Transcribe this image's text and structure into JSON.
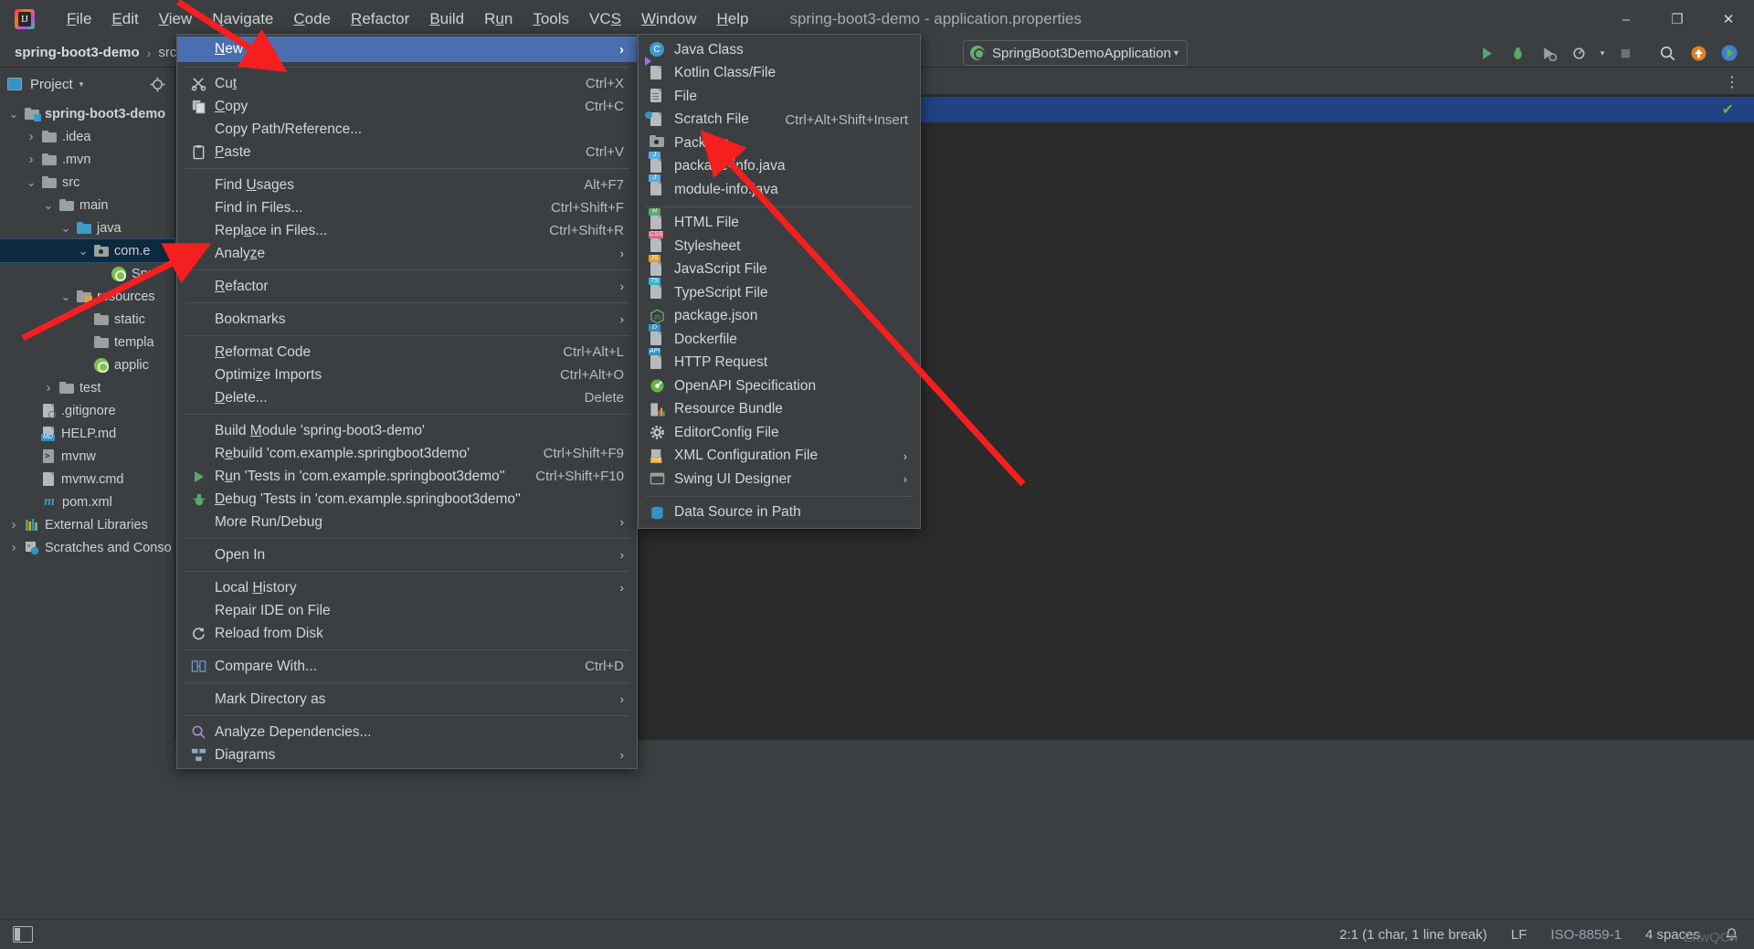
{
  "titlebar": {
    "menus": [
      {
        "label": "File",
        "mnemonic": "F"
      },
      {
        "label": "Edit",
        "mnemonic": "E"
      },
      {
        "label": "View",
        "mnemonic": "V"
      },
      {
        "label": "Navigate",
        "mnemonic": "N"
      },
      {
        "label": "Code",
        "mnemonic": "C"
      },
      {
        "label": "Refactor",
        "mnemonic": "R"
      },
      {
        "label": "Build",
        "mnemonic": "B"
      },
      {
        "label": "Run",
        "mnemonic": "u"
      },
      {
        "label": "Tools",
        "mnemonic": "T"
      },
      {
        "label": "VCS",
        "mnemonic": "S"
      },
      {
        "label": "Window",
        "mnemonic": "W"
      },
      {
        "label": "Help",
        "mnemonic": "H"
      }
    ],
    "window_title": "spring-boot3-demo - application.properties",
    "minimize": "–",
    "maximize": "❐",
    "close": "✕"
  },
  "navbar": {
    "crumbs": [
      "spring-boot3-demo",
      "src"
    ],
    "separator": "›",
    "run_config": "SpringBoot3DemoApplication",
    "run_caret": "▾"
  },
  "project_panel": {
    "title": "Project",
    "caret": "▾",
    "tree": [
      {
        "label": "spring-boot3-demo",
        "depth": 0,
        "arrow": "down",
        "icon": "module-folder",
        "bold": true
      },
      {
        "label": ".idea",
        "depth": 1,
        "arrow": "right",
        "icon": "folder"
      },
      {
        "label": ".mvn",
        "depth": 1,
        "arrow": "right",
        "icon": "folder"
      },
      {
        "label": "src",
        "depth": 1,
        "arrow": "down",
        "icon": "folder"
      },
      {
        "label": "main",
        "depth": 2,
        "arrow": "down",
        "icon": "folder"
      },
      {
        "label": "java",
        "depth": 3,
        "arrow": "down",
        "icon": "source-folder"
      },
      {
        "label": "com.e",
        "depth": 4,
        "arrow": "down",
        "icon": "package",
        "selected": true
      },
      {
        "label": "Spr",
        "depth": 5,
        "arrow": "none",
        "icon": "spring-class"
      },
      {
        "label": "resources",
        "depth": 3,
        "arrow": "down",
        "icon": "resources-folder"
      },
      {
        "label": "static",
        "depth": 4,
        "arrow": "none",
        "icon": "folder"
      },
      {
        "label": "templa",
        "depth": 4,
        "arrow": "none",
        "icon": "folder"
      },
      {
        "label": "applic",
        "depth": 4,
        "arrow": "none",
        "icon": "spring-properties"
      },
      {
        "label": "test",
        "depth": 2,
        "arrow": "right",
        "icon": "folder"
      },
      {
        "label": ".gitignore",
        "depth": 1,
        "arrow": "none",
        "icon": "gitignore-file"
      },
      {
        "label": "HELP.md",
        "depth": 1,
        "arrow": "none",
        "icon": "md-file"
      },
      {
        "label": "mvnw",
        "depth": 1,
        "arrow": "none",
        "icon": "shell-file"
      },
      {
        "label": "mvnw.cmd",
        "depth": 1,
        "arrow": "none",
        "icon": "cmd-file"
      },
      {
        "label": "pom.xml",
        "depth": 1,
        "arrow": "none",
        "icon": "maven-file"
      },
      {
        "label": "External Libraries",
        "depth": 0,
        "arrow": "right",
        "icon": "libraries"
      },
      {
        "label": "Scratches and Conso",
        "depth": 0,
        "arrow": "right",
        "icon": "scratches"
      }
    ]
  },
  "context_menu": {
    "items": [
      {
        "label": "New",
        "mnemonic": "N",
        "icon": "",
        "submenu": true,
        "highlighted": true
      },
      {
        "separator": true
      },
      {
        "label": "Cut",
        "mnemonic": "t",
        "icon": "scissors-icon",
        "accel": "Ctrl+X"
      },
      {
        "label": "Copy",
        "mnemonic": "C",
        "icon": "copy-icon",
        "accel": "Ctrl+C"
      },
      {
        "label": "Copy Path/Reference...",
        "icon": ""
      },
      {
        "label": "Paste",
        "mnemonic": "P",
        "icon": "paste-icon",
        "accel": "Ctrl+V"
      },
      {
        "separator": true
      },
      {
        "label": "Find Usages",
        "mnemonic": "U",
        "icon": "",
        "accel": "Alt+F7"
      },
      {
        "label": "Find in Files...",
        "icon": "",
        "accel": "Ctrl+Shift+F"
      },
      {
        "label": "Replace in Files...",
        "mnemonic": "a",
        "icon": "",
        "accel": "Ctrl+Shift+R"
      },
      {
        "label": "Analyze",
        "mnemonic": "z",
        "icon": "",
        "submenu": true
      },
      {
        "separator": true
      },
      {
        "label": "Refactor",
        "mnemonic": "R",
        "icon": "",
        "submenu": true
      },
      {
        "separator": true
      },
      {
        "label": "Bookmarks",
        "icon": "",
        "submenu": true
      },
      {
        "separator": true
      },
      {
        "label": "Reformat Code",
        "mnemonic": "R",
        "icon": "",
        "accel": "Ctrl+Alt+L"
      },
      {
        "label": "Optimize Imports",
        "mnemonic": "z",
        "icon": "",
        "accel": "Ctrl+Alt+O"
      },
      {
        "label": "Delete...",
        "mnemonic": "D",
        "icon": "",
        "accel": "Delete"
      },
      {
        "separator": true
      },
      {
        "label": "Build Module 'spring-boot3-demo'",
        "mnemonic": "M",
        "icon": ""
      },
      {
        "label": "Rebuild 'com.example.springboot3demo'",
        "mnemonic": "e",
        "icon": "",
        "accel": "Ctrl+Shift+F9"
      },
      {
        "label": "Run 'Tests in 'com.example.springboot3demo''",
        "mnemonic": "u",
        "icon": "run-icon",
        "accel": "Ctrl+Shift+F10"
      },
      {
        "label": "Debug 'Tests in 'com.example.springboot3demo''",
        "mnemonic": "D",
        "icon": "debug-icon"
      },
      {
        "label": "More Run/Debug",
        "icon": "",
        "submenu": true
      },
      {
        "separator": true
      },
      {
        "label": "Open In",
        "icon": "",
        "submenu": true
      },
      {
        "separator": true
      },
      {
        "label": "Local History",
        "mnemonic": "H",
        "icon": "",
        "submenu": true
      },
      {
        "label": "Repair IDE on File",
        "icon": ""
      },
      {
        "label": "Reload from Disk",
        "icon": "reload-icon"
      },
      {
        "separator": true
      },
      {
        "label": "Compare With...",
        "icon": "compare-icon",
        "accel": "Ctrl+D"
      },
      {
        "separator": true
      },
      {
        "label": "Mark Directory as",
        "icon": "",
        "submenu": true
      },
      {
        "separator": true
      },
      {
        "label": "Analyze Dependencies...",
        "icon": "analyze-icon"
      },
      {
        "label": "Diagrams",
        "icon": "diagrams-icon",
        "submenu": true
      }
    ]
  },
  "submenu": {
    "items": [
      {
        "label": "Java Class",
        "icon": "java-class-icon",
        "icon_color": "#3d9bc8",
        "icon_text": "C"
      },
      {
        "label": "Kotlin Class/File",
        "icon": "kotlin-file-icon",
        "icon_color": "#9b6ef3",
        "icon_text": ""
      },
      {
        "label": "File",
        "icon": "file-icon",
        "icon_color": "",
        "icon_text": ""
      },
      {
        "label": "Scratch File",
        "icon": "scratch-file-icon",
        "icon_color": "#3592c4",
        "icon_text": "",
        "accel": "Ctrl+Alt+Shift+Insert"
      },
      {
        "label": "Package",
        "icon": "package-icon",
        "icon_color": "#9aa0a4",
        "icon_text": ""
      },
      {
        "label": "package-info.java",
        "icon": "java-file-icon",
        "icon_color": "#57b0dd",
        "icon_text": "J"
      },
      {
        "label": "module-info.java",
        "icon": "java-file-icon",
        "icon_color": "#57b0dd",
        "icon_text": "J"
      },
      {
        "separator": true
      },
      {
        "label": "HTML File",
        "icon": "html-file-icon",
        "icon_color": "#59a869",
        "icon_text": "H"
      },
      {
        "label": "Stylesheet",
        "icon": "css-file-icon",
        "icon_color": "#d9687f",
        "icon_text": "CSS"
      },
      {
        "label": "JavaScript File",
        "icon": "js-file-icon",
        "icon_color": "#e0a22c",
        "icon_text": "JS"
      },
      {
        "label": "TypeScript File",
        "icon": "ts-file-icon",
        "icon_color": "#32b3d6",
        "icon_text": "TS"
      },
      {
        "label": "package.json",
        "icon": "nodejs-icon",
        "icon_color": "#6aab73",
        "icon_text": "JS"
      },
      {
        "label": "Dockerfile",
        "icon": "docker-file-icon",
        "icon_color": "#3592c4",
        "icon_text": "D"
      },
      {
        "label": "HTTP Request",
        "icon": "http-request-icon",
        "icon_color": "#3592c4",
        "icon_text": "API"
      },
      {
        "label": "OpenAPI Specification",
        "icon": "openapi-icon",
        "icon_color": "#62b543",
        "icon_text": ""
      },
      {
        "label": "Resource Bundle",
        "icon": "resource-bundle-icon",
        "icon_color": "#d9a441",
        "icon_text": ""
      },
      {
        "label": "EditorConfig File",
        "icon": "gear-icon",
        "icon_color": "#c7cacc",
        "icon_text": ""
      },
      {
        "label": "XML Configuration File",
        "icon": "xml-config-icon",
        "icon_color": "#e0a22c",
        "icon_text": "X",
        "submenu": true
      },
      {
        "label": "Swing UI Designer",
        "icon": "swing-ui-icon",
        "icon_color": "#9aa0a4",
        "icon_text": "",
        "submenu": true
      },
      {
        "separator": true
      },
      {
        "label": "Data Source in Path",
        "icon": "data-source-icon",
        "icon_color": "#3592c4",
        "icon_text": ""
      }
    ],
    "chevron": "›"
  },
  "statusbar": {
    "caret_position": "2:1 (1 char, 1 line break)",
    "line_separator": "LF",
    "encoding": "ISO-8859-1",
    "indent": "4 spaces",
    "watermark": "ZnwQCn"
  }
}
